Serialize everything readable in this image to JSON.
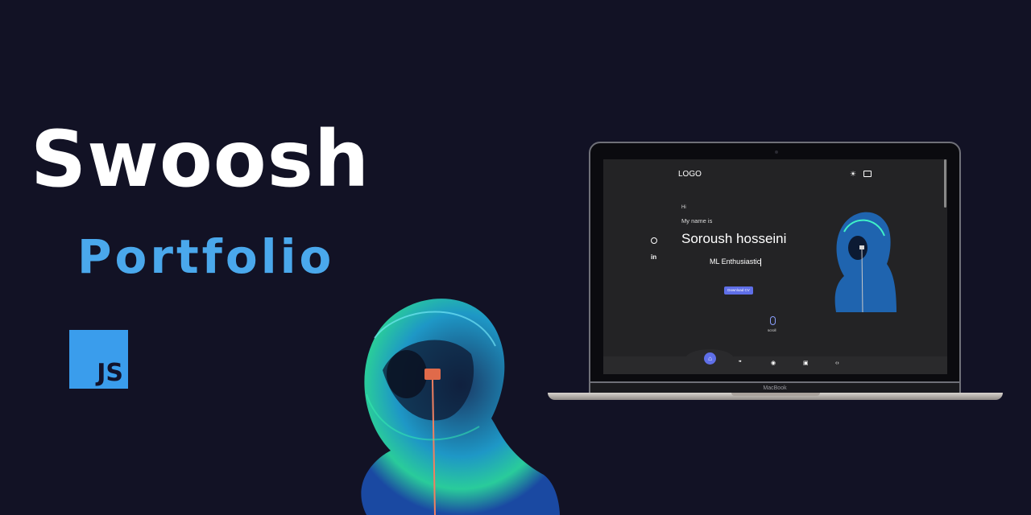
{
  "hero": {
    "title": "Swoosh",
    "subtitle": "Portfolio",
    "badge": "JS"
  },
  "laptop": {
    "brand": "MacBook"
  },
  "site": {
    "logo": "LOGO",
    "greeting": "Hi",
    "intro": "My name is",
    "name": "Soroush hosseini",
    "role": "ML Enthusiastic",
    "cv_button": "Download CV",
    "scroll_label": "scroll",
    "header_icons": [
      "sun-icon",
      "flag-icon"
    ],
    "social_icons": [
      "github-icon",
      "linkedin-icon"
    ],
    "nav_icons": [
      "home-icon",
      "quote-icon",
      "brain-icon",
      "briefcase-icon",
      "code-icon"
    ],
    "linkedin_glyph": "in"
  },
  "colors": {
    "background": "#121225",
    "accent_blue": "#4aa8ec",
    "button": "#5f6fe8",
    "screen_bg": "#232325"
  }
}
